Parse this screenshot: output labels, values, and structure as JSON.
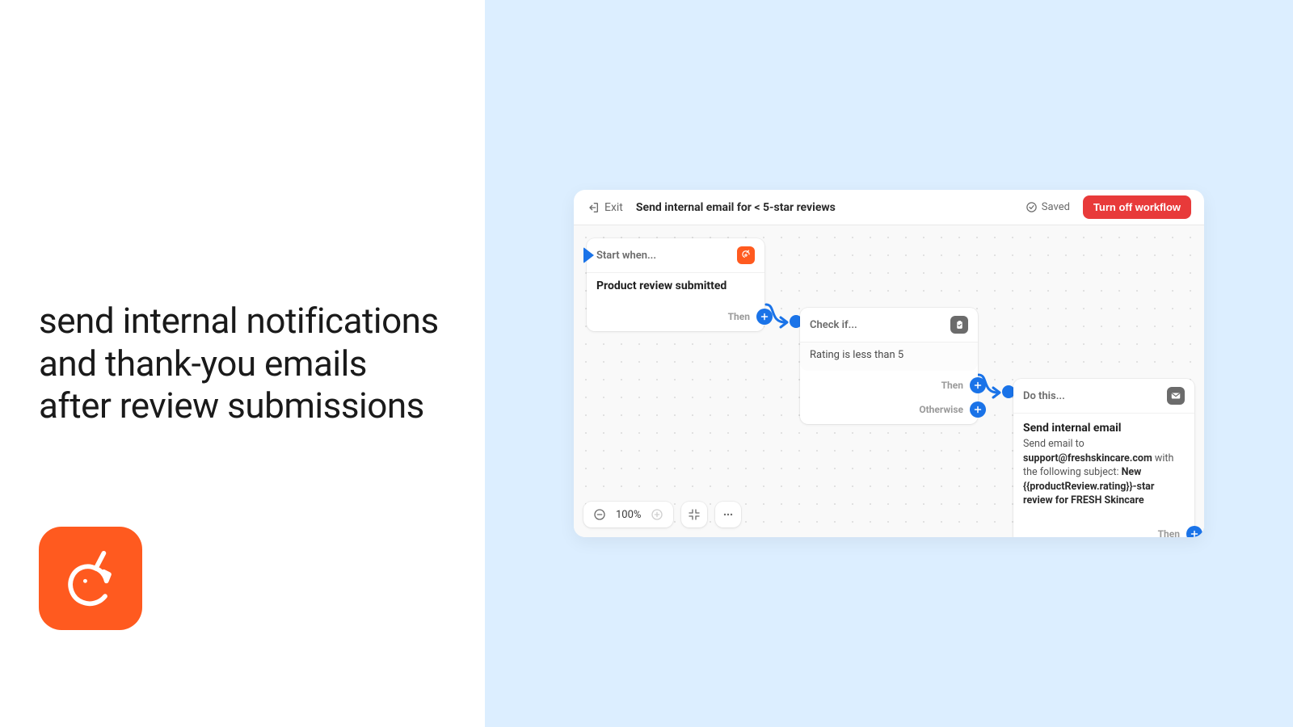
{
  "left": {
    "headline": "send internal notifications and thank-you emails after review submissions"
  },
  "window": {
    "exit_label": "Exit",
    "title": "Send internal email for < 5-star reviews",
    "saved_label": "Saved",
    "turn_off_label": "Turn off workflow"
  },
  "nodes": {
    "trigger": {
      "label": "Start when...",
      "content": "Product review submitted",
      "then_label": "Then"
    },
    "condition": {
      "label": "Check if...",
      "content": "Rating is less than 5",
      "then_label": "Then",
      "otherwise_label": "Otherwise"
    },
    "action": {
      "label": "Do this...",
      "title": "Send internal email",
      "desc_prefix": "Send email to ",
      "email": "support@freshskincare.com",
      "desc_mid": " with the following subject: ",
      "subject": "New {{productReview.rating}}-star review for FRESH Skincare",
      "then_label": "Then"
    }
  },
  "zoom": {
    "level": "100%"
  }
}
